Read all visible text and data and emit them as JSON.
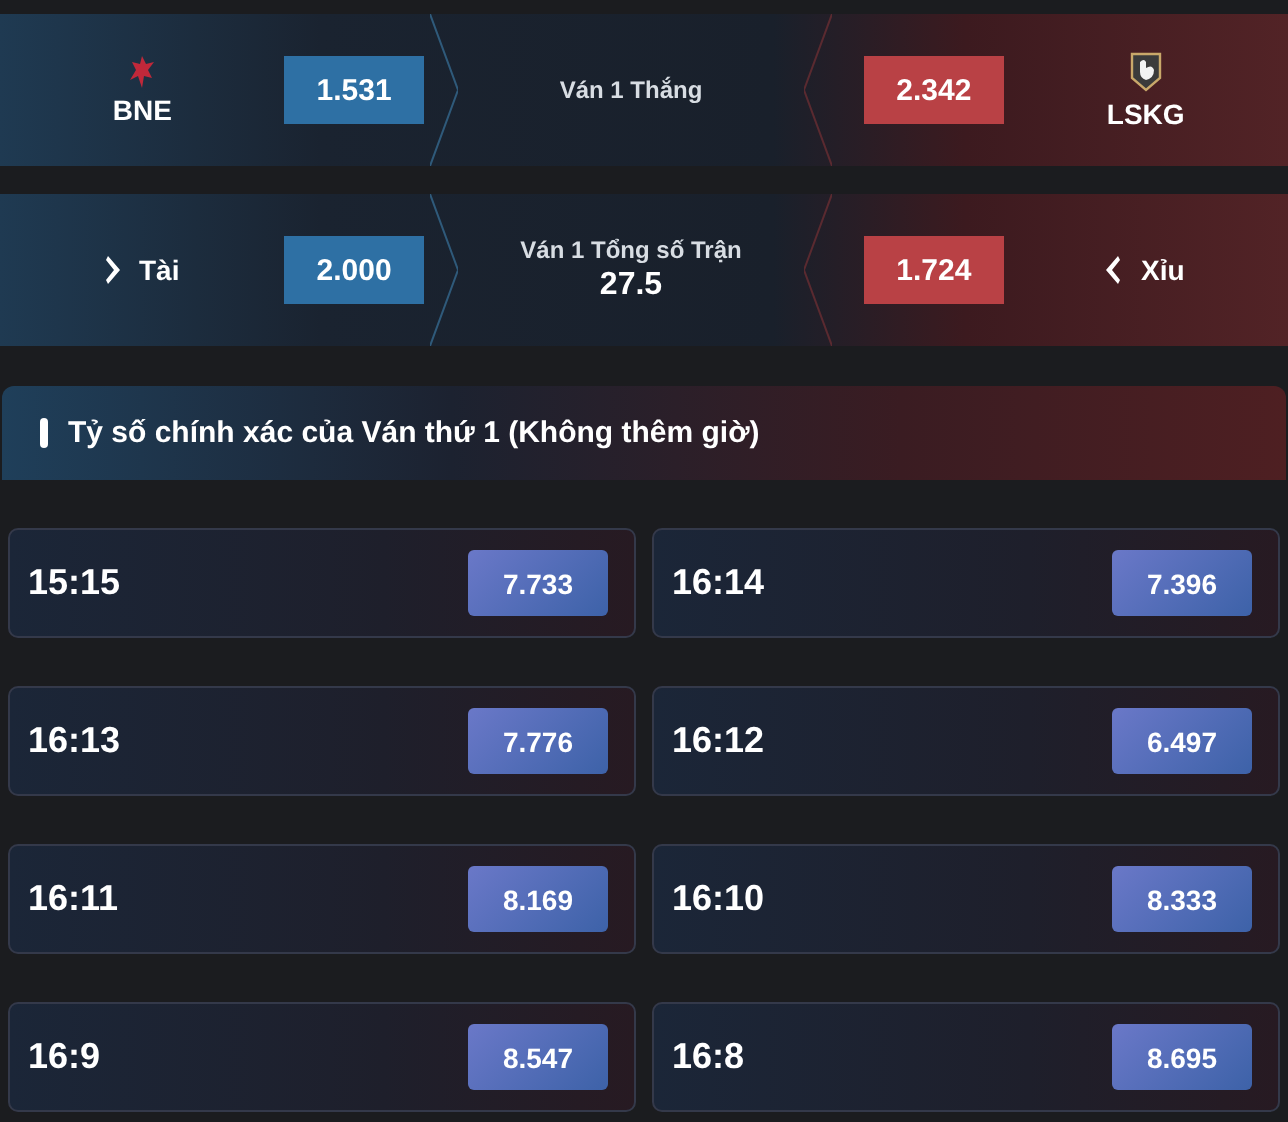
{
  "markets": [
    {
      "kind": "match",
      "left_label": "BNE",
      "left_odds": "1.531",
      "title": "Ván 1 Thắng",
      "right_odds": "2.342",
      "right_label": "LSKG"
    },
    {
      "kind": "total",
      "left_label": "Tài",
      "left_odds": "2.000",
      "title": "Ván 1 Tổng số Trận",
      "value": "27.5",
      "right_odds": "1.724",
      "right_label": "Xỉu"
    }
  ],
  "section": {
    "title": "Tỷ số chính xác của Ván thứ 1 (Không thêm giờ)",
    "scores": [
      {
        "score": "15:15",
        "odds": "7.733"
      },
      {
        "score": "16:14",
        "odds": "7.396"
      },
      {
        "score": "16:13",
        "odds": "7.776"
      },
      {
        "score": "16:12",
        "odds": "6.497"
      },
      {
        "score": "16:11",
        "odds": "8.169"
      },
      {
        "score": "16:10",
        "odds": "8.333"
      },
      {
        "score": "16:9",
        "odds": "8.547"
      },
      {
        "score": "16:8",
        "odds": "8.695"
      }
    ]
  }
}
